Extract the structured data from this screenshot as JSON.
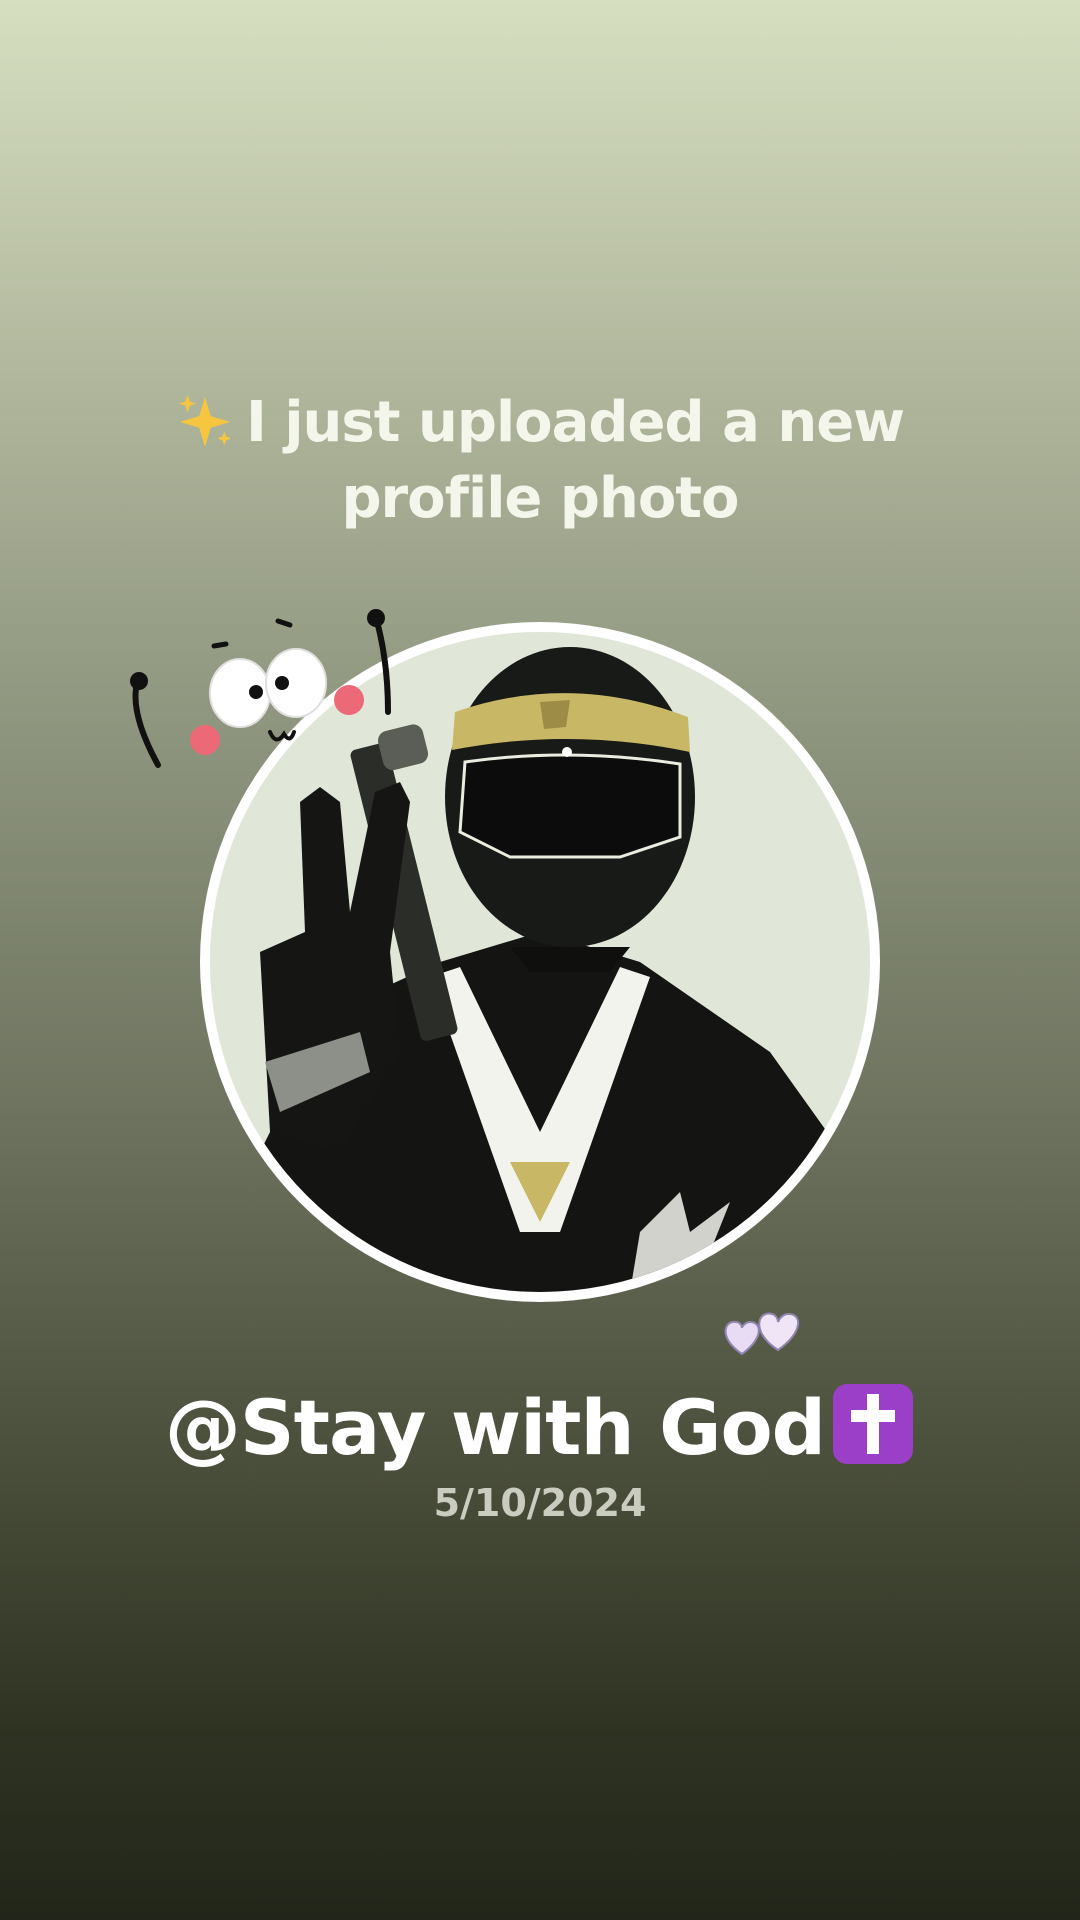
{
  "headline": {
    "line1": "I just uploaded a new",
    "line2": "profile photo",
    "icon": "sparkles-icon"
  },
  "profile": {
    "username": "@Stay with God",
    "badge_icon": "latin-cross-icon",
    "date": "5/10/2024"
  },
  "decorations": {
    "doodle": "cartoon-face-doodle",
    "hearts": "hearts-icon"
  },
  "colors": {
    "background_top": "#d7dfc1",
    "background_bottom": "#22261a",
    "ring": "#ffffff",
    "badge": "#9b3fc8",
    "helmet_visor": "#c8b765"
  }
}
